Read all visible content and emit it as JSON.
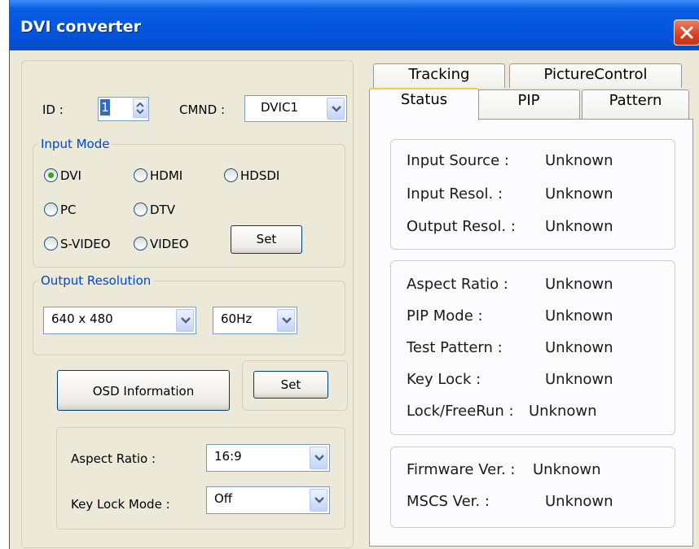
{
  "window": {
    "title": "DVI converter"
  },
  "left": {
    "id_label": "ID :",
    "id_value": "1",
    "cmnd_label": "CMND :",
    "cmnd_value": "DVIC1",
    "input_mode": {
      "title": "Input Mode",
      "options": [
        "DVI",
        "HDMI",
        "HDSDI",
        "PC",
        "DTV",
        "S-VIDEO",
        "VIDEO"
      ],
      "selected": "DVI",
      "set_label": "Set"
    },
    "output_resolution": {
      "title": "Output Resolution",
      "resolution": "640 x 480",
      "refresh": "60Hz"
    },
    "osd_label": "OSD  Information",
    "set2_label": "Set",
    "aspect_ratio_label": "Aspect Ratio :",
    "aspect_ratio_value": "16:9",
    "key_lock_label": "Key Lock Mode :",
    "key_lock_value": "Off"
  },
  "tabs": {
    "back_row": [
      "Tracking",
      "PictureControl"
    ],
    "front_row": [
      "Status",
      "PIP",
      "Pattern"
    ],
    "active": "Status"
  },
  "status": {
    "group1": [
      {
        "label": "Input Source :",
        "value": "Unknown"
      },
      {
        "label": "Input Resol. :",
        "value": "Unknown"
      },
      {
        "label": "Output Resol. :",
        "value": "Unknown"
      }
    ],
    "group2": [
      {
        "label": "Aspect Ratio :",
        "value": "Unknown"
      },
      {
        "label": "PIP Mode :",
        "value": "Unknown"
      },
      {
        "label": "Test Pattern :",
        "value": "Unknown"
      },
      {
        "label": "Key Lock :",
        "value": "Unknown"
      },
      {
        "label": "Lock/FreeRun :",
        "value": "Unknown"
      }
    ],
    "group3": [
      {
        "label": "Firmware Ver. :",
        "value": "Unknown"
      },
      {
        "label": "MSCS Ver. :",
        "value": "Unknown"
      }
    ]
  }
}
